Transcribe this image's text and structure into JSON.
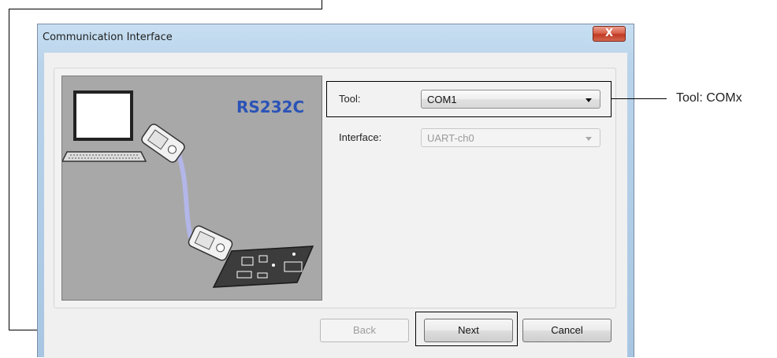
{
  "dialog": {
    "title": "Communication Interface",
    "close_icon": "close-icon"
  },
  "image_panel": {
    "label": "RS232C"
  },
  "fields": {
    "tool_label": "Tool:",
    "tool_value": "COM1",
    "interface_label": "Interface:",
    "interface_value": "UART-ch0"
  },
  "buttons": {
    "back": "Back",
    "next": "Next",
    "cancel": "Cancel"
  },
  "annotation": {
    "tool": "Tool: COMx"
  },
  "colors": {
    "label_blue": "#2b53b7",
    "close_red": "#c03a24"
  }
}
